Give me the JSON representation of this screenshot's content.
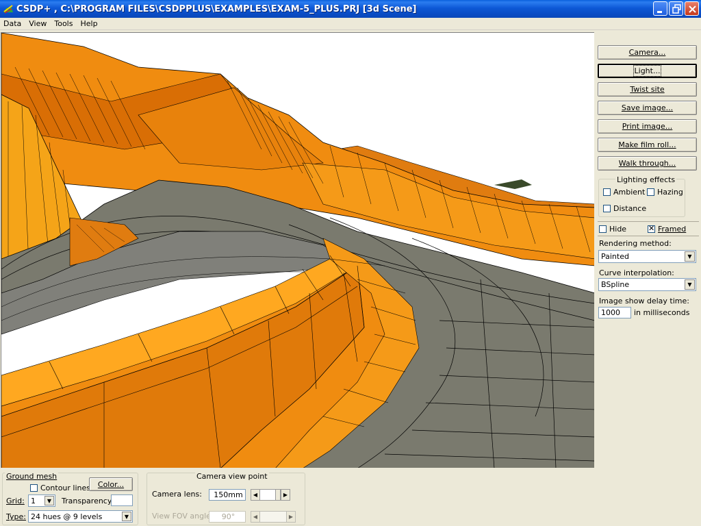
{
  "window": {
    "title": "CSDP+ , C:\\PROGRAM FILES\\CSDPPLUS\\EXAMPLES\\EXAM-5_PLUS.PRJ [3d Scene]",
    "icon": "csdp-app-icon"
  },
  "menu": [
    "Data",
    "View",
    "Tools",
    "Help"
  ],
  "right_panel": {
    "buttons": [
      "Camera...",
      "Light...",
      "Twist site",
      "Save image...",
      "Print image...",
      "Make film roll...",
      "Walk through..."
    ],
    "lighting_effects": {
      "title": "Lighting effects",
      "ambient": {
        "label": "Ambient",
        "checked": false
      },
      "hazing": {
        "label": "Hazing",
        "checked": false
      },
      "distance": {
        "label": "Distance",
        "checked": false
      }
    },
    "hide": {
      "label": "Hide",
      "checked": false
    },
    "framed": {
      "label": "Framed",
      "checked": true
    },
    "rendering_method": {
      "label": "Rendering method:",
      "value": "Painted"
    },
    "curve_interpolation": {
      "label": "Curve interpolation:",
      "value": "BSpline"
    },
    "image_delay": {
      "label": "Image show delay time:",
      "value": "1000",
      "unit": "in milliseconds"
    }
  },
  "bottom_panel": {
    "ground_mesh": {
      "title": "Ground mesh",
      "contour_lines": {
        "label": "Contour lines",
        "checked": false
      },
      "color_button": "Color...",
      "grid_label": "Grid:",
      "grid_value": "1",
      "transparency_label": "Transparency:",
      "transparency_value": "",
      "type_label": "Type:",
      "type_value": "24 hues @ 9 levels"
    },
    "camera_view_point": {
      "title": "Camera view point",
      "lens_label": "Camera lens:",
      "lens_value": "150mm",
      "fov_label": "View FOV angle:",
      "fov_value": "90°"
    }
  },
  "colors": {
    "terrain_orange": "#f08c10",
    "terrain_light": "#ffa820",
    "terrain_dark": "#c85a00",
    "road_gray": "#7a7a6e",
    "sky": "#ffffff"
  }
}
